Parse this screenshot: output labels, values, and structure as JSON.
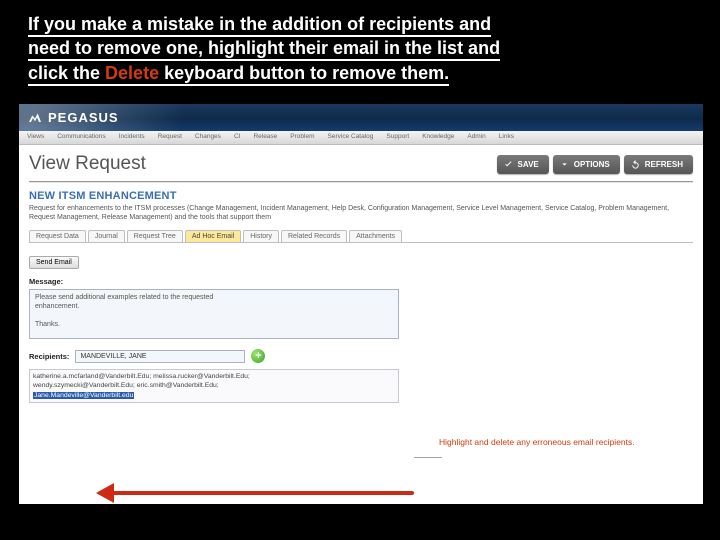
{
  "instruction": {
    "line1": "If you make a mistake in the addition of recipients and",
    "line2a": "need to remove one, highlight their email in the list and",
    "line3a": "click the ",
    "delete_word": "Delete",
    "line3b": " keyboard button to remove them."
  },
  "app": {
    "brand": "PEGASUS",
    "menu": [
      "Views",
      "Communications",
      "Incidents",
      "Request",
      "Changes",
      "CI",
      "Release",
      "Problem",
      "Service Catalog",
      "Support",
      "Knowledge",
      "Admin",
      "Links"
    ],
    "page_title": "View Request",
    "buttons": {
      "save": "SAVE",
      "options": "OPTIONS",
      "refresh": "REFRESH"
    },
    "section_title": "NEW ITSM ENHANCEMENT",
    "section_desc": "Request for enhancements to the ITSM processes (Change Management, Incident Management, Help Desk, Configuration Management, Service Level Management, Service Catalog, Problem Management, Request Management, Release Management) and the tools that support them",
    "tabs": [
      "Request Data",
      "Journal",
      "Request Tree",
      "Ad Hoc Email",
      "History",
      "Related Records",
      "Attachments"
    ],
    "active_tab_index": 3,
    "send_btn": "Send Email",
    "message_label": "Message:",
    "message_lines": [
      "Please send additional examples related to the requested",
      "enhancement.",
      "",
      "Thanks."
    ],
    "recipients_label": "Recipients:",
    "recipient_input": "MANDEVILLE, JANE",
    "emails": {
      "line1": "katherine.a.mcfarland@Vanderbilt.Edu; melissa.rucker@Vanderbilt.Edu;",
      "line2": "wendy.szymecki@Vanderbilt.Edu; eric.smith@Vanderbilt.Edu;",
      "selected": "Jane.Mandeville@Vanderbilt.edu"
    }
  },
  "callout": "Highlight and delete any erroneous email recipients."
}
